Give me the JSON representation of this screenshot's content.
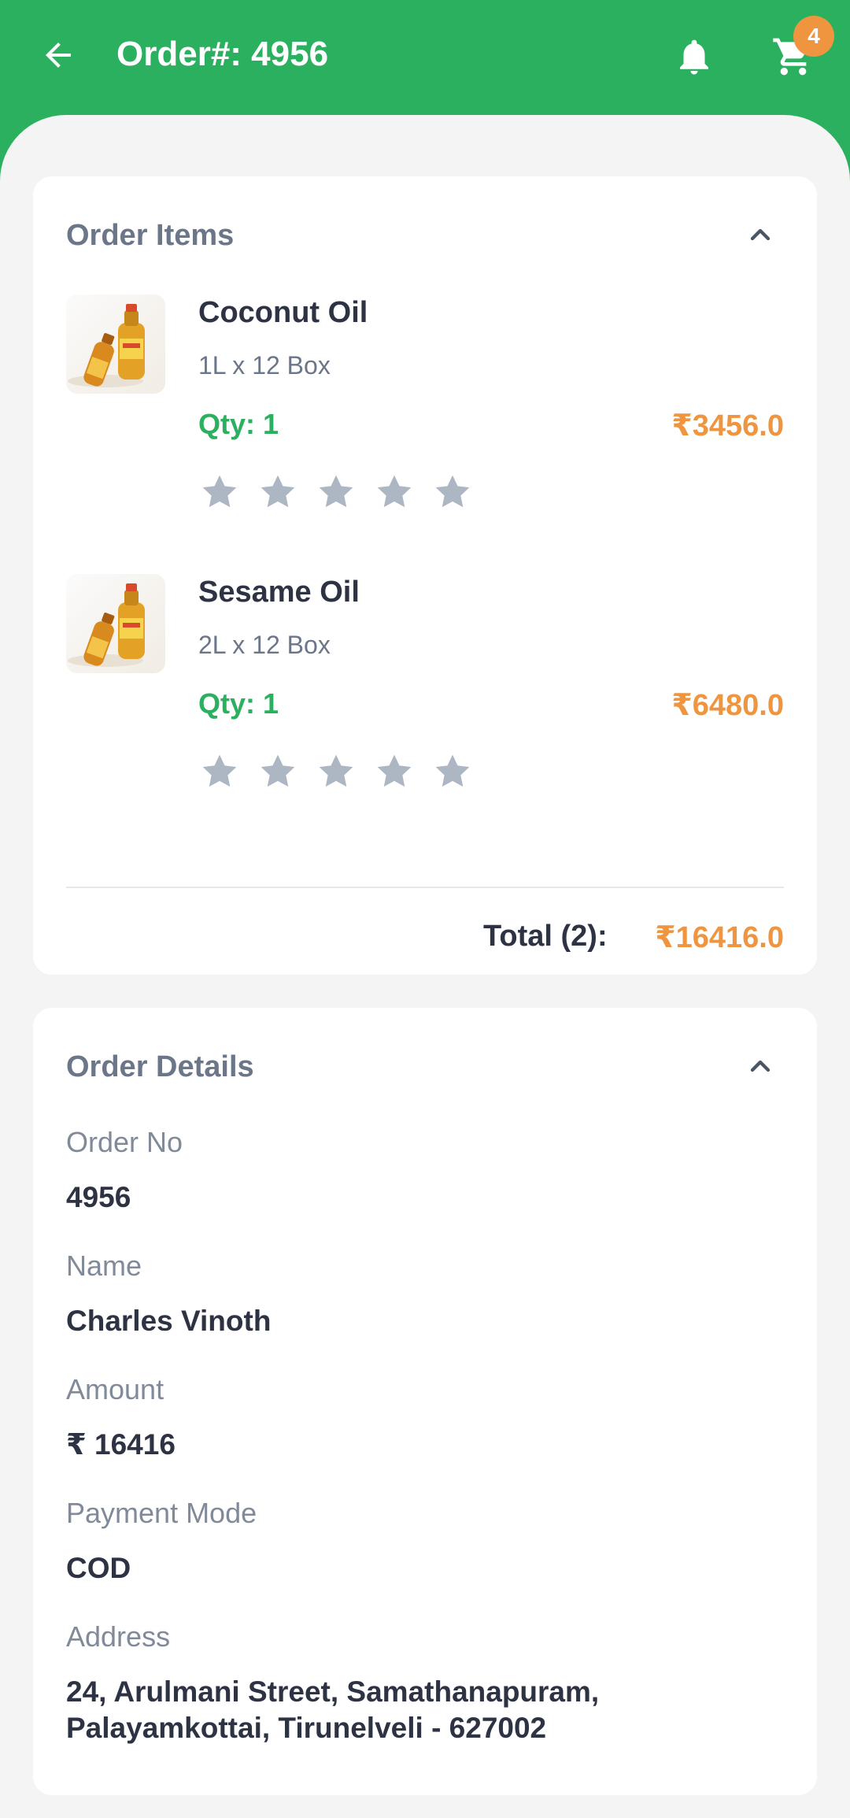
{
  "header": {
    "title": "Order#: 4956",
    "cart_badge": "4",
    "colors": {
      "bar": "#2bb05f",
      "badge": "#f0953f"
    }
  },
  "order_items": {
    "title": "Order Items",
    "items": [
      {
        "name": "Coconut Oil",
        "size": "1L x 12 Box",
        "qty": "Qty: 1",
        "price": "₹3456.0",
        "rating": 0
      },
      {
        "name": "Sesame Oil",
        "size": "2L x 12 Box",
        "qty": "Qty: 1",
        "price": "₹6480.0",
        "rating": 0
      }
    ],
    "total_label": "Total (2):",
    "total_value": "₹16416.0"
  },
  "order_details": {
    "title": "Order Details",
    "fields": [
      {
        "label": "Order No",
        "value": "4956"
      },
      {
        "label": "Name",
        "value": "Charles Vinoth"
      },
      {
        "label": "Amount",
        "value": "₹ 16416"
      },
      {
        "label": "Payment Mode",
        "value": "COD"
      },
      {
        "label": "Address",
        "value": "24, Arulmani Street, Samathanapuram, Palayamkottai, Tirunelveli - 627002"
      }
    ]
  }
}
